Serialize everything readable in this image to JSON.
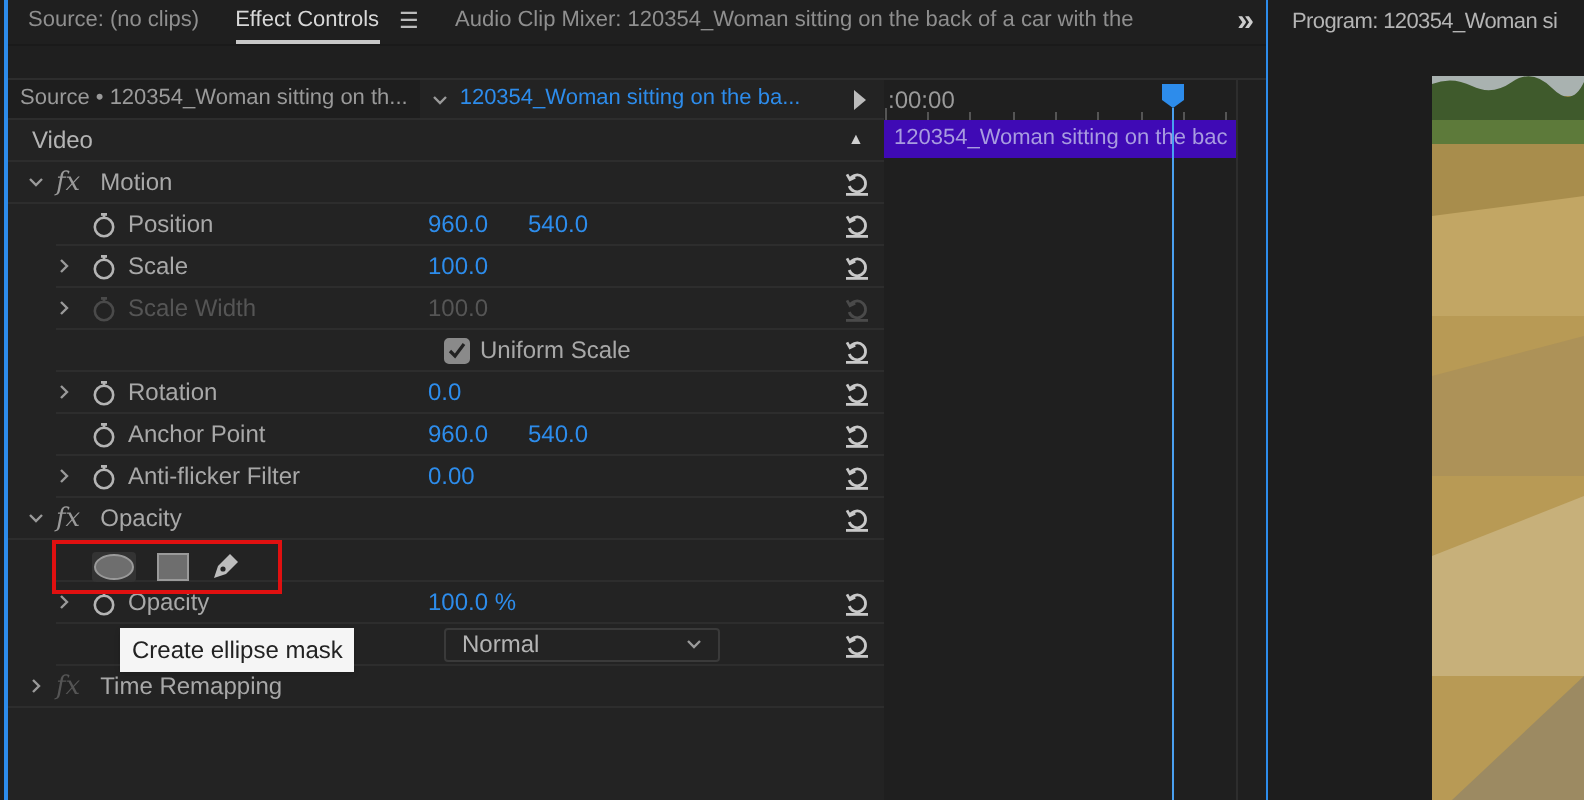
{
  "tabs": [
    {
      "label": "Source: (no clips)",
      "selected": false
    },
    {
      "label": "Effect Controls",
      "selected": true,
      "menu": "☰"
    },
    {
      "label": "Audio Clip Mixer: 120354_Woman sitting on the back of a car with the",
      "selected": false
    }
  ],
  "overflow": "»",
  "header": {
    "source": "Source • 120354_Woman sitting on th...",
    "clip": "120354_Woman sitting on the ba..."
  },
  "timeline": {
    "timecode": ":00:00",
    "clip": "120354_Woman sitting on the bac"
  },
  "rows": [
    {
      "kind": "section",
      "label": "Video",
      "collapse": "▲"
    },
    {
      "kind": "effect",
      "fx": "fx",
      "label": "Motion",
      "expanded": true,
      "disabled": false
    },
    {
      "kind": "property",
      "label": "Position",
      "values": [
        "960.0",
        "540.0"
      ],
      "twirl": false,
      "disabled": false
    },
    {
      "kind": "property",
      "label": "Scale",
      "values": [
        "100.0"
      ],
      "twirl": true,
      "disabled": false
    },
    {
      "kind": "property",
      "label": "Scale Width",
      "values": [
        "100.0"
      ],
      "twirl": true,
      "disabled": true
    },
    {
      "kind": "checkbox",
      "label": "Uniform Scale",
      "checked": true
    },
    {
      "kind": "property",
      "label": "Rotation",
      "values": [
        "0.0"
      ],
      "twirl": true,
      "disabled": false
    },
    {
      "kind": "property",
      "label": "Anchor Point",
      "values": [
        "960.0",
        "540.0"
      ],
      "twirl": false,
      "disabled": false
    },
    {
      "kind": "property",
      "label": "Anti-flicker Filter",
      "values": [
        "0.00"
      ],
      "twirl": true,
      "disabled": false
    },
    {
      "kind": "effect",
      "fx": "fx",
      "label": "Opacity",
      "expanded": true,
      "disabled": false
    },
    {
      "kind": "masks"
    },
    {
      "kind": "property",
      "label": "Opacity",
      "values": [
        "100.0 %"
      ],
      "twirl": true,
      "disabled": false
    },
    {
      "kind": "dropdown",
      "value": "Normal"
    },
    {
      "kind": "effect",
      "fx": "fx",
      "label": "Time Remapping",
      "expanded": false,
      "disabled": true
    }
  ],
  "tooltip": "Create ellipse mask",
  "program": {
    "title": "Program: 120354_Woman si"
  }
}
